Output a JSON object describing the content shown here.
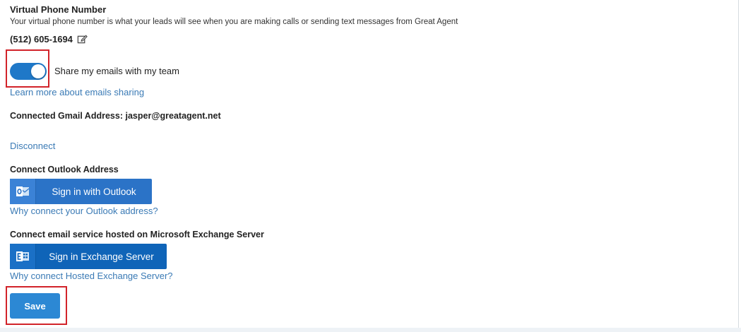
{
  "virtual_phone": {
    "title": "Virtual Phone Number",
    "description": "Your virtual phone number is what your leads will see when you are making calls or sending text messages from Great Agent",
    "number": "(512) 605-1694",
    "edit_icon": "edit-icon"
  },
  "email_sharing": {
    "toggle_on": true,
    "label": "Share my emails with my team",
    "learn_more": "Learn more about emails sharing"
  },
  "gmail": {
    "label": "Connected Gmail Address:",
    "address": "jasper@greatagent.net",
    "disconnect": "Disconnect"
  },
  "outlook": {
    "title": "Connect Outlook Address",
    "button_label": "Sign in with Outlook",
    "button_icon": "outlook-icon",
    "why_link": "Why connect your Outlook address?"
  },
  "exchange": {
    "title": "Connect email service hosted on Microsoft Exchange Server",
    "button_label": "Sign in Exchange Server",
    "button_icon": "exchange-icon",
    "why_link": "Why connect Hosted Exchange Server?"
  },
  "save_label": "Save",
  "colors": {
    "primary": "#2c88d4",
    "link": "#3a7ab5",
    "toggle": "#1f78c8",
    "highlight": "#d2232a"
  }
}
